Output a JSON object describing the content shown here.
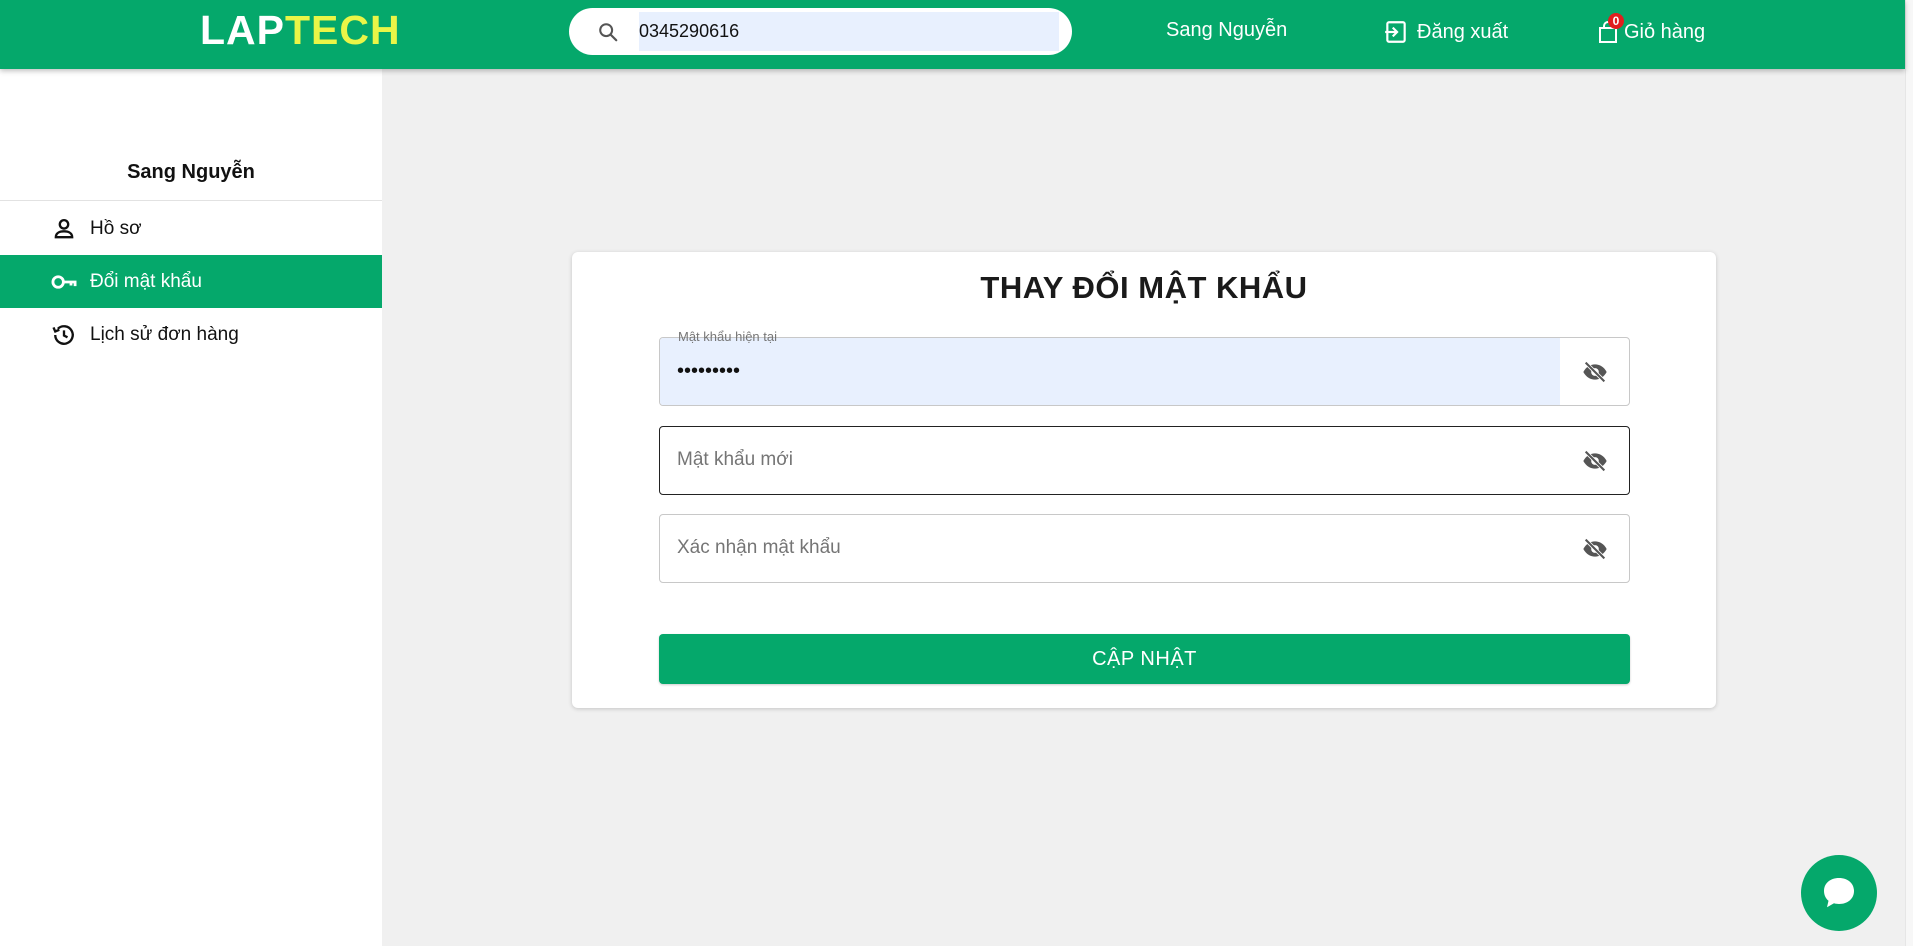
{
  "header": {
    "logo_part1": "LAP",
    "logo_part2": "TECH",
    "search_value": "0345290616",
    "user_name": "Sang Nguyễn",
    "logout_label": "Đăng xuất",
    "cart_label": "Giỏ hàng",
    "cart_count": "0"
  },
  "sidebar": {
    "user_name": "Sang Nguyễn",
    "items": [
      {
        "label": "Hồ sơ",
        "icon": "person-icon",
        "active": false
      },
      {
        "label": "Đổi mật khẩu",
        "icon": "key-icon",
        "active": true
      },
      {
        "label": "Lịch sử đơn hàng",
        "icon": "history-icon",
        "active": false
      }
    ]
  },
  "form": {
    "title": "THAY ĐỔI MẬT KHẨU",
    "current_password_label": "Mật khẩu hiện tại",
    "current_password_value": "•••••••••",
    "new_password_placeholder": "Mật khẩu mới",
    "confirm_password_placeholder": "Xác nhận mật khẩu",
    "submit_label": "CẬP NHẬT"
  },
  "colors": {
    "brand": "#05a86b",
    "logo_accent": "#eaf547",
    "autofill": "#e8f0fe",
    "badge": "#e01e1e"
  }
}
